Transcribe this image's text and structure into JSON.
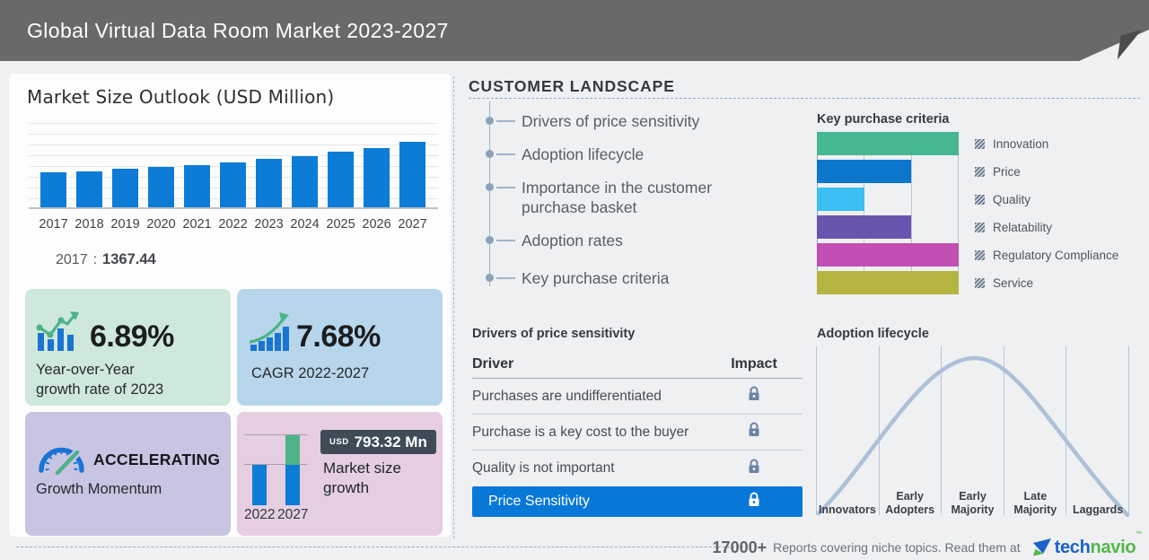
{
  "header": {
    "title": "Global Virtual Data Room Market 2023-2027"
  },
  "market_outlook": {
    "title": "Market Size Outlook (USD Million)",
    "callout": {
      "year": "2017",
      "separator": ":",
      "value": "1367.44"
    }
  },
  "stat_cards": {
    "yoy": {
      "value": "6.89%",
      "label": "Year-over-Year\ngrowth rate of 2023",
      "icon": "bar-chart-trend-up-icon"
    },
    "cagr": {
      "value": "7.68%",
      "label": "CAGR 2022-2027",
      "icon": "ascending-bars-arrow-icon"
    },
    "momentum": {
      "value": "ACCELERATING",
      "label": "Growth Momentum",
      "icon": "speedometer-icon"
    },
    "size_growth": {
      "currency": "USD",
      "amount": "793.32 Mn",
      "label": "Market size\ngrowth",
      "years": [
        "2022",
        "2027"
      ]
    }
  },
  "customer_landscape": {
    "title": "CUSTOMER LANDSCAPE",
    "items": [
      "Drivers of price sensitivity",
      "Adoption lifecycle",
      "Importance in the customer purchase basket",
      "Adoption rates",
      "Key purchase criteria"
    ]
  },
  "key_purchase_criteria": {
    "title": "Key purchase criteria"
  },
  "price_sensitivity": {
    "title": "Drivers of price sensitivity",
    "columns": [
      "Driver",
      "Impact"
    ],
    "rows": [
      "Purchases are undifferentiated",
      "Purchase is a key cost to the buyer",
      "Quality is not important"
    ],
    "highlight": "Price Sensitivity"
  },
  "adoption_lifecycle": {
    "title": "Adoption lifecycle",
    "stages": [
      "Innovators",
      "Early Adopters",
      "Early Majority",
      "Late Majority",
      "Laggards"
    ]
  },
  "footer": {
    "count": "17000+",
    "text": "Reports covering niche topics. Read them at",
    "brand": {
      "blue": "tech",
      "green": "navio",
      "mark": "™"
    }
  },
  "chart_data": [
    {
      "id": "market-size-outlook",
      "type": "bar",
      "title": "Market Size Outlook (USD Million)",
      "ylabel": "USD Million",
      "categories": [
        "2017",
        "2018",
        "2019",
        "2020",
        "2021",
        "2022",
        "2023",
        "2024",
        "2025",
        "2026",
        "2027"
      ],
      "values": [
        1367.44,
        1424.6,
        1519.2,
        1589.9,
        1671.4,
        1773.9,
        1896.1,
        2013.8,
        2190.5,
        2342.6,
        2567.2
      ],
      "labeled_values": {
        "2017": 1367.44
      },
      "ylim": [
        0,
        3390
      ],
      "grid": "horizontal",
      "bar_color": "#0d7cd6",
      "legend_position": "none"
    },
    {
      "id": "key-purchase-criteria",
      "type": "bar",
      "orientation": "horizontal",
      "title": "Key purchase criteria",
      "categories": [
        "Innovation",
        "Price",
        "Quality",
        "Relatability",
        "Regulatory Compliance",
        "Service"
      ],
      "values": [
        3,
        2,
        1,
        2,
        3,
        3
      ],
      "xlim": [
        0,
        3
      ],
      "colors": [
        "#45b793",
        "#0b77cc",
        "#3bbff2",
        "#6a55ae",
        "#c24fb4",
        "#b6b441"
      ],
      "grid": "vertical",
      "legend_position": "right"
    },
    {
      "id": "market-size-growth",
      "type": "bar",
      "stacked": true,
      "title": "Market size growth",
      "categories": [
        "2022",
        "2027"
      ],
      "series": [
        {
          "name": "market size",
          "values": [
            1773.9,
            1773.9
          ],
          "color": "#0d7cd6"
        },
        {
          "name": "growth",
          "values": [
            0,
            793.32
          ],
          "color": "#4db388"
        }
      ],
      "annotation": "USD 793.32 Mn"
    },
    {
      "id": "adoption-lifecycle",
      "type": "area",
      "shape": "bell_curve",
      "title": "Adoption lifecycle",
      "categories": [
        "Innovators",
        "Early Adopters",
        "Early Majority",
        "Late Majority",
        "Laggards"
      ],
      "peak_stage": "Early Majority",
      "line_color": "#adc0d7",
      "grid": "vertical"
    }
  ],
  "colors": {
    "header_bg": "#696968",
    "page_bg": "#eef0f2",
    "card_bg": "#fdfdfd",
    "primary_blue": "#0d7cd6",
    "accent_green": "#4db388",
    "yoy_box": "#cfe8dc",
    "cagr_box": "#b8d6eb",
    "momentum_box": "#c8c5e3",
    "growth_box": "#e5cee2",
    "badge_bg": "#3f4c58",
    "highlight_row": "#0778d8",
    "lock_icon": "#6b83a3",
    "dashed_line": "#8fafca",
    "curve": "#adc0d7",
    "logo_blue": "#1b63c6",
    "logo_green": "#52b748"
  }
}
